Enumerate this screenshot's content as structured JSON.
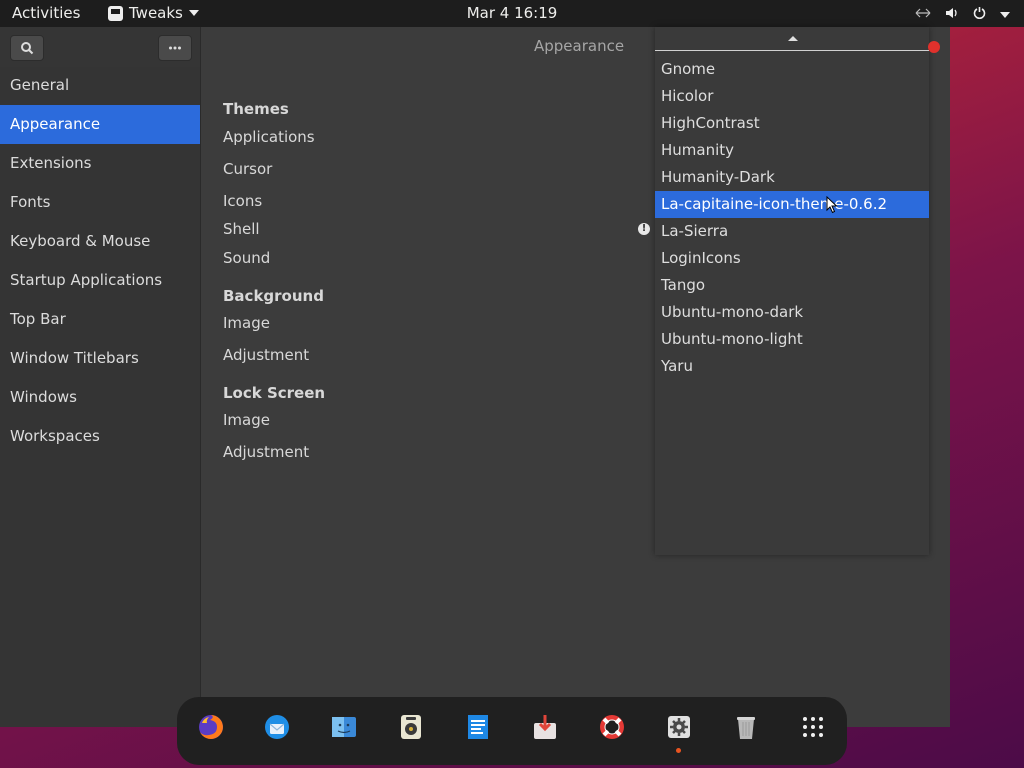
{
  "topbar": {
    "activities": "Activities",
    "app_name": "Tweaks",
    "clock": "Mar 4  16:19"
  },
  "sidebar": {
    "items": [
      {
        "label": "General"
      },
      {
        "label": "Appearance",
        "active": true
      },
      {
        "label": "Extensions"
      },
      {
        "label": "Fonts"
      },
      {
        "label": "Keyboard & Mouse"
      },
      {
        "label": "Startup Applications"
      },
      {
        "label": "Top Bar"
      },
      {
        "label": "Window Titlebars"
      },
      {
        "label": "Windows"
      },
      {
        "label": "Workspaces"
      }
    ]
  },
  "main": {
    "title": "Appearance",
    "themes_heading": "Themes",
    "themes": [
      "Applications",
      "Cursor",
      "Icons",
      "Shell",
      "Sound"
    ],
    "background_heading": "Background",
    "background": [
      "Image",
      "Adjustment"
    ],
    "lockscreen_heading": "Lock Screen",
    "lockscreen": [
      "Image",
      "Adjustment"
    ]
  },
  "popup": {
    "options": [
      "Gnome",
      "Hicolor",
      "HighContrast",
      "Humanity",
      "Humanity-Dark",
      "La-capitaine-icon-theme-0.6.2",
      "La-Sierra",
      "LoginIcons",
      "Tango",
      "Ubuntu-mono-dark",
      "Ubuntu-mono-light",
      "Yaru"
    ],
    "selected": "La-capitaine-icon-theme-0.6.2"
  },
  "dock": {
    "icons": [
      "firefox-icon",
      "thunderbird-icon",
      "files-icon",
      "rhythmbox-icon",
      "writer-icon",
      "software-install-icon",
      "help-icon",
      "tweaks-settings-icon",
      "trash-icon",
      "app-grid-icon"
    ]
  },
  "colors": {
    "accent": "#2c6bdc",
    "topbar": "#1d1d1d",
    "window": "#3c3c3c",
    "sidebar": "#343434",
    "dock": "#202020"
  }
}
